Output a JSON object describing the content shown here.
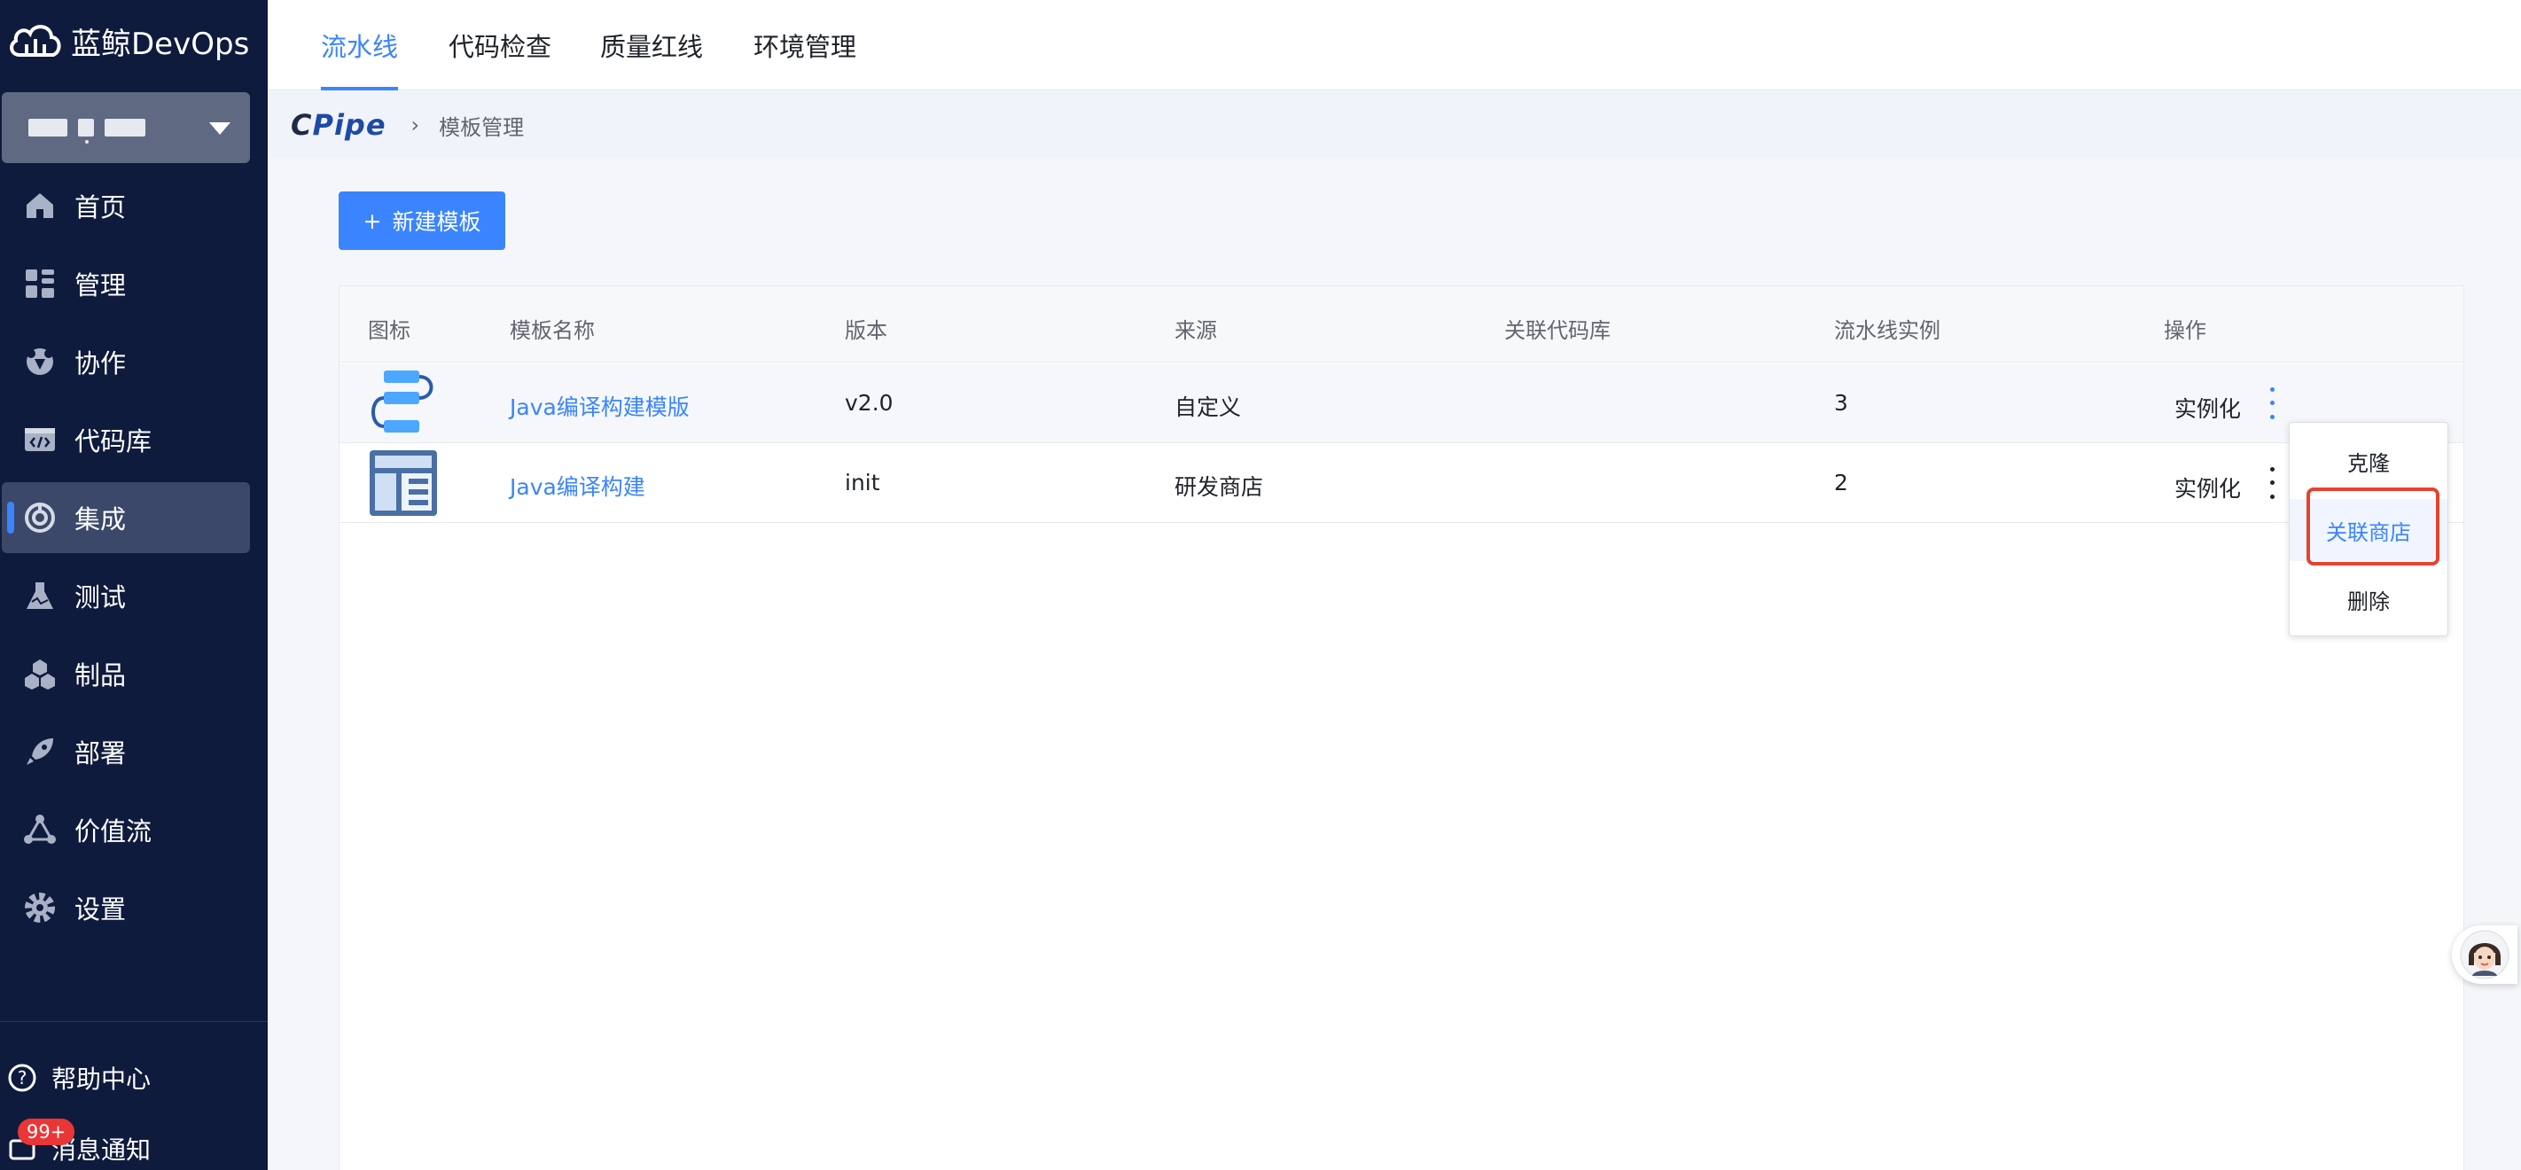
{
  "app": {
    "brand": "蓝鲸DevOps"
  },
  "colors": {
    "accent": "#3a84ff",
    "sidebar_bg": "#0f1b3d",
    "highlight_border": "#e5432f"
  },
  "sidebar": {
    "items": [
      {
        "label": "首页",
        "icon": "home-icon"
      },
      {
        "label": "管理",
        "icon": "grid-icon"
      },
      {
        "label": "协作",
        "icon": "collab-icon"
      },
      {
        "label": "代码库",
        "icon": "code-icon"
      },
      {
        "label": "集成",
        "icon": "integrate-icon",
        "active": true
      },
      {
        "label": "测试",
        "icon": "flask-icon"
      },
      {
        "label": "制品",
        "icon": "cubes-icon"
      },
      {
        "label": "部署",
        "icon": "rocket-icon"
      },
      {
        "label": "价值流",
        "icon": "flow-icon"
      },
      {
        "label": "设置",
        "icon": "gear-icon"
      }
    ],
    "help": "帮助中心",
    "notify": "消息通知",
    "badge": "99+"
  },
  "topnav": {
    "tabs": [
      "流水线",
      "代码检查",
      "质量红线",
      "环境管理"
    ]
  },
  "breadcrumb": {
    "logo_c": "C",
    "logo_rest": "Pipe",
    "sep": "›",
    "current": "模板管理"
  },
  "toolbar": {
    "new_label": "新建模板",
    "plus": "+"
  },
  "table": {
    "headers": [
      "图标",
      "模板名称",
      "版本",
      "来源",
      "关联代码库",
      "流水线实例",
      "操作"
    ],
    "rows": [
      {
        "name": "Java编译构建模版",
        "version": "v2.0",
        "source": "自定义",
        "repo": "",
        "instances": "3",
        "action": "实例化"
      },
      {
        "name": "Java编译构建",
        "version": "init",
        "source": "研发商店",
        "repo": "",
        "instances": "2",
        "action": "实例化"
      }
    ]
  },
  "dropdown": {
    "items": [
      "克隆",
      "关联商店",
      "删除"
    ]
  }
}
